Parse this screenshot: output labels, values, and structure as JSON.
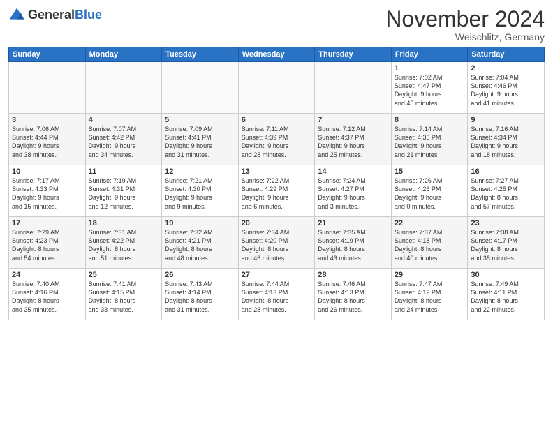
{
  "header": {
    "logo_general": "General",
    "logo_blue": "Blue",
    "month_title": "November 2024",
    "location": "Weischlitz, Germany"
  },
  "calendar": {
    "days_of_week": [
      "Sunday",
      "Monday",
      "Tuesday",
      "Wednesday",
      "Thursday",
      "Friday",
      "Saturday"
    ],
    "weeks": [
      [
        {
          "day": "",
          "info": ""
        },
        {
          "day": "",
          "info": ""
        },
        {
          "day": "",
          "info": ""
        },
        {
          "day": "",
          "info": ""
        },
        {
          "day": "",
          "info": ""
        },
        {
          "day": "1",
          "info": "Sunrise: 7:02 AM\nSunset: 4:47 PM\nDaylight: 9 hours\nand 45 minutes."
        },
        {
          "day": "2",
          "info": "Sunrise: 7:04 AM\nSunset: 4:46 PM\nDaylight: 9 hours\nand 41 minutes."
        }
      ],
      [
        {
          "day": "3",
          "info": "Sunrise: 7:06 AM\nSunset: 4:44 PM\nDaylight: 9 hours\nand 38 minutes."
        },
        {
          "day": "4",
          "info": "Sunrise: 7:07 AM\nSunset: 4:42 PM\nDaylight: 9 hours\nand 34 minutes."
        },
        {
          "day": "5",
          "info": "Sunrise: 7:09 AM\nSunset: 4:41 PM\nDaylight: 9 hours\nand 31 minutes."
        },
        {
          "day": "6",
          "info": "Sunrise: 7:11 AM\nSunset: 4:39 PM\nDaylight: 9 hours\nand 28 minutes."
        },
        {
          "day": "7",
          "info": "Sunrise: 7:12 AM\nSunset: 4:37 PM\nDaylight: 9 hours\nand 25 minutes."
        },
        {
          "day": "8",
          "info": "Sunrise: 7:14 AM\nSunset: 4:36 PM\nDaylight: 9 hours\nand 21 minutes."
        },
        {
          "day": "9",
          "info": "Sunrise: 7:16 AM\nSunset: 4:34 PM\nDaylight: 9 hours\nand 18 minutes."
        }
      ],
      [
        {
          "day": "10",
          "info": "Sunrise: 7:17 AM\nSunset: 4:33 PM\nDaylight: 9 hours\nand 15 minutes."
        },
        {
          "day": "11",
          "info": "Sunrise: 7:19 AM\nSunset: 4:31 PM\nDaylight: 9 hours\nand 12 minutes."
        },
        {
          "day": "12",
          "info": "Sunrise: 7:21 AM\nSunset: 4:30 PM\nDaylight: 9 hours\nand 9 minutes."
        },
        {
          "day": "13",
          "info": "Sunrise: 7:22 AM\nSunset: 4:29 PM\nDaylight: 9 hours\nand 6 minutes."
        },
        {
          "day": "14",
          "info": "Sunrise: 7:24 AM\nSunset: 4:27 PM\nDaylight: 9 hours\nand 3 minutes."
        },
        {
          "day": "15",
          "info": "Sunrise: 7:26 AM\nSunset: 4:26 PM\nDaylight: 9 hours\nand 0 minutes."
        },
        {
          "day": "16",
          "info": "Sunrise: 7:27 AM\nSunset: 4:25 PM\nDaylight: 8 hours\nand 57 minutes."
        }
      ],
      [
        {
          "day": "17",
          "info": "Sunrise: 7:29 AM\nSunset: 4:23 PM\nDaylight: 8 hours\nand 54 minutes."
        },
        {
          "day": "18",
          "info": "Sunrise: 7:31 AM\nSunset: 4:22 PM\nDaylight: 8 hours\nand 51 minutes."
        },
        {
          "day": "19",
          "info": "Sunrise: 7:32 AM\nSunset: 4:21 PM\nDaylight: 8 hours\nand 48 minutes."
        },
        {
          "day": "20",
          "info": "Sunrise: 7:34 AM\nSunset: 4:20 PM\nDaylight: 8 hours\nand 46 minutes."
        },
        {
          "day": "21",
          "info": "Sunrise: 7:35 AM\nSunset: 4:19 PM\nDaylight: 8 hours\nand 43 minutes."
        },
        {
          "day": "22",
          "info": "Sunrise: 7:37 AM\nSunset: 4:18 PM\nDaylight: 8 hours\nand 40 minutes."
        },
        {
          "day": "23",
          "info": "Sunrise: 7:38 AM\nSunset: 4:17 PM\nDaylight: 8 hours\nand 38 minutes."
        }
      ],
      [
        {
          "day": "24",
          "info": "Sunrise: 7:40 AM\nSunset: 4:16 PM\nDaylight: 8 hours\nand 35 minutes."
        },
        {
          "day": "25",
          "info": "Sunrise: 7:41 AM\nSunset: 4:15 PM\nDaylight: 8 hours\nand 33 minutes."
        },
        {
          "day": "26",
          "info": "Sunrise: 7:43 AM\nSunset: 4:14 PM\nDaylight: 8 hours\nand 31 minutes."
        },
        {
          "day": "27",
          "info": "Sunrise: 7:44 AM\nSunset: 4:13 PM\nDaylight: 8 hours\nand 28 minutes."
        },
        {
          "day": "28",
          "info": "Sunrise: 7:46 AM\nSunset: 4:13 PM\nDaylight: 8 hours\nand 26 minutes."
        },
        {
          "day": "29",
          "info": "Sunrise: 7:47 AM\nSunset: 4:12 PM\nDaylight: 8 hours\nand 24 minutes."
        },
        {
          "day": "30",
          "info": "Sunrise: 7:49 AM\nSunset: 4:11 PM\nDaylight: 8 hours\nand 22 minutes."
        }
      ]
    ]
  }
}
